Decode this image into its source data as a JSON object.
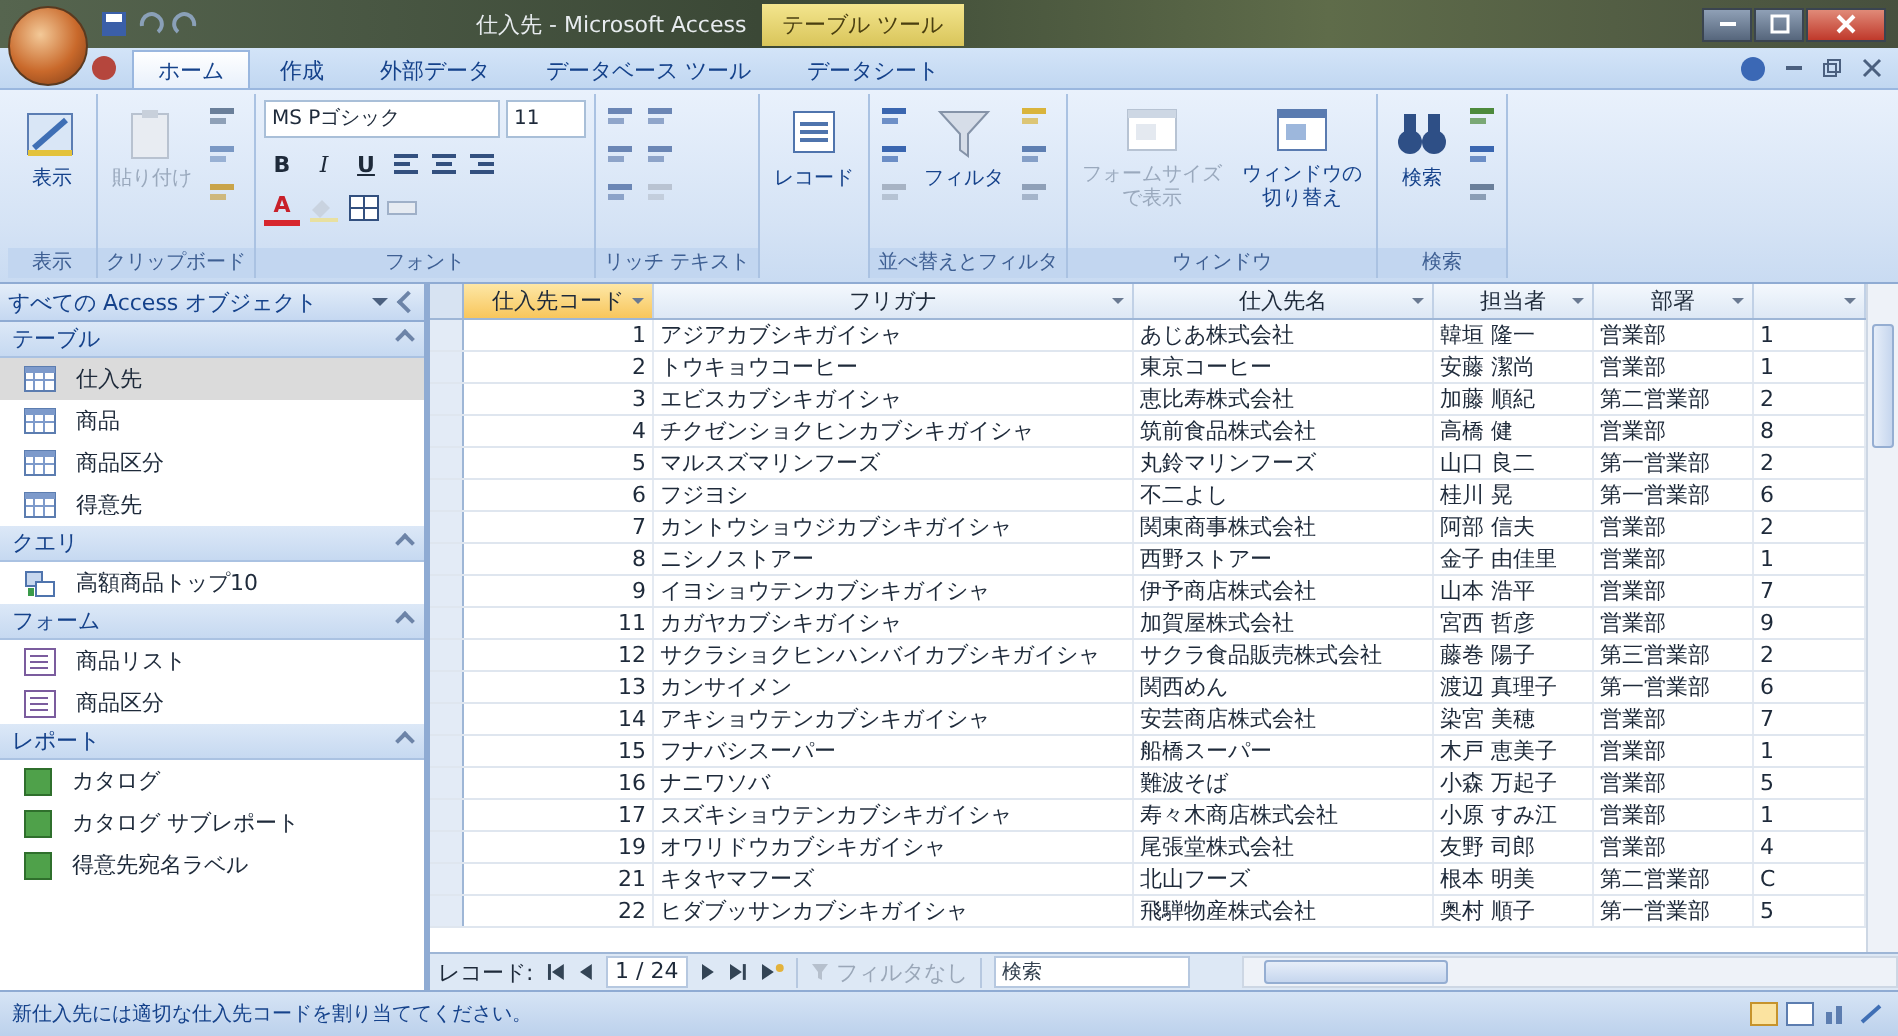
{
  "window": {
    "title": "仕入先 - Microsoft Access",
    "context_tab": "テーブル ツール"
  },
  "ribbon_tabs": [
    {
      "label": "ホーム",
      "selected": true
    },
    {
      "label": "作成",
      "selected": false
    },
    {
      "label": "外部データ",
      "selected": false
    },
    {
      "label": "データベース ツール",
      "selected": false
    },
    {
      "label": "データシート",
      "selected": false
    }
  ],
  "ribbon_groups": [
    {
      "kind": "view",
      "label": "表示",
      "buttons": [
        {
          "lines": [
            "表示"
          ],
          "disabled": false
        }
      ]
    },
    {
      "kind": "clipboard",
      "label": "クリップボード",
      "buttons": [
        {
          "lines": [
            "貼り付け"
          ],
          "disabled": true
        }
      ]
    },
    {
      "kind": "font",
      "label": "フォント",
      "font": "MS Pゴシック",
      "size": "11",
      "styles": [
        "B",
        "I",
        "U"
      ],
      "color_glyph": "A"
    },
    {
      "kind": "richtext",
      "label": "リッチ テキスト"
    },
    {
      "kind": "records",
      "buttons": [
        {
          "lines": [
            "レコード"
          ],
          "disabled": false
        }
      ]
    },
    {
      "kind": "sort",
      "label": "並べ替えとフィルタ",
      "buttons": [
        {
          "lines": [
            "フィルタ"
          ],
          "disabled": false
        }
      ]
    },
    {
      "kind": "window",
      "label": "ウィンドウ",
      "buttons": [
        {
          "lines": [
            "フォームサイズ",
            "で表示"
          ],
          "disabled": true
        },
        {
          "lines": [
            "ウィンドウの",
            "切り替え"
          ],
          "disabled": false
        }
      ]
    },
    {
      "kind": "find",
      "label": "検索",
      "buttons": [
        {
          "lines": [
            "検索"
          ],
          "disabled": false
        }
      ]
    }
  ],
  "navigation_pane": {
    "title": "すべての Access オブジェクト",
    "groups": [
      {
        "kind": "table",
        "label": "テーブル",
        "items": [
          {
            "label": "仕入先",
            "selected": true
          },
          {
            "label": "商品",
            "selected": false
          },
          {
            "label": "商品区分",
            "selected": false
          },
          {
            "label": "得意先",
            "selected": false
          }
        ]
      },
      {
        "kind": "query",
        "label": "クエリ",
        "items": [
          {
            "label": "高額商品トップ10",
            "selected": false
          }
        ]
      },
      {
        "kind": "form",
        "label": "フォーム",
        "items": [
          {
            "label": "商品リスト",
            "selected": false
          },
          {
            "label": "商品区分",
            "selected": false
          }
        ]
      },
      {
        "kind": "report",
        "label": "レポート",
        "items": [
          {
            "label": "カタログ",
            "selected": false
          },
          {
            "label": "カタログ サブレポート",
            "selected": false
          },
          {
            "label": "得意先宛名ラベル",
            "selected": false
          }
        ]
      }
    ]
  },
  "table": {
    "columns": [
      {
        "label": "仕入先コード",
        "selected": true
      },
      {
        "label": "フリガナ",
        "selected": false
      },
      {
        "label": "仕入先名",
        "selected": false
      },
      {
        "label": "担当者",
        "selected": false
      },
      {
        "label": "部署",
        "selected": false
      },
      {
        "selected": false
      }
    ],
    "rows": [
      [
        "1",
        "アジアカブシキガイシャ",
        "あじあ株式会社",
        "韓垣 隆一",
        "営業部",
        "1"
      ],
      [
        "2",
        "トウキョウコーヒー",
        "東京コーヒー",
        "安藤 潔尚",
        "営業部",
        "1"
      ],
      [
        "3",
        "エビスカブシキガイシャ",
        "恵比寿株式会社",
        "加藤 順紀",
        "第二営業部",
        "2"
      ],
      [
        "4",
        "チクゼンショクヒンカブシキガイシャ",
        "筑前食品株式会社",
        "高橋 健",
        "営業部",
        "8"
      ],
      [
        "5",
        "マルスズマリンフーズ",
        "丸鈴マリンフーズ",
        "山口 良二",
        "第一営業部",
        "2"
      ],
      [
        "6",
        "フジヨシ",
        "不二よし",
        "桂川 晃",
        "第一営業部",
        "6"
      ],
      [
        "7",
        "カントウショウジカブシキガイシャ",
        "関東商事株式会社",
        "阿部 信夫",
        "営業部",
        "2"
      ],
      [
        "8",
        "ニシノストアー",
        "西野ストアー",
        "金子 由佳里",
        "営業部",
        "1"
      ],
      [
        "9",
        "イヨショウテンカブシキガイシャ",
        "伊予商店株式会社",
        "山本 浩平",
        "営業部",
        "7"
      ],
      [
        "11",
        "カガヤカブシキガイシャ",
        "加賀屋株式会社",
        "宮西 哲彦",
        "営業部",
        "9"
      ],
      [
        "12",
        "サクラショクヒンハンバイカブシキガイシャ",
        "サクラ食品販売株式会社",
        "藤巻 陽子",
        "第三営業部",
        "2"
      ],
      [
        "13",
        "カンサイメン",
        "関西めん",
        "渡辺 真理子",
        "第一営業部",
        "6"
      ],
      [
        "14",
        "アキショウテンカブシキガイシャ",
        "安芸商店株式会社",
        "染宮 美穂",
        "営業部",
        "7"
      ],
      [
        "15",
        "フナバシスーパー",
        "船橋スーパー",
        "木戸 恵美子",
        "営業部",
        "1"
      ],
      [
        "16",
        "ナニワソバ",
        "難波そば",
        "小森 万起子",
        "営業部",
        "5"
      ],
      [
        "17",
        "スズキショウテンカブシキガイシャ",
        "寿々木商店株式会社",
        "小原 すみ江",
        "営業部",
        "1"
      ],
      [
        "19",
        "オワリドウカブシキガイシャ",
        "尾張堂株式会社",
        "友野 司郎",
        "営業部",
        "4"
      ],
      [
        "21",
        "キタヤマフーズ",
        "北山フーズ",
        "根本 明美",
        "第二営業部",
        "C"
      ],
      [
        "22",
        "ヒダブッサンカブシキガイシャ",
        "飛騨物産株式会社",
        "奥村 順子",
        "第一営業部",
        "5"
      ]
    ]
  },
  "record_navigator": {
    "label": "レコード:",
    "position": "1 / 24",
    "filter": "フィルタなし",
    "search_placeholder": "検索"
  },
  "status_bar": {
    "message": "新仕入先には適切な仕入先コードを割り当ててください。"
  }
}
